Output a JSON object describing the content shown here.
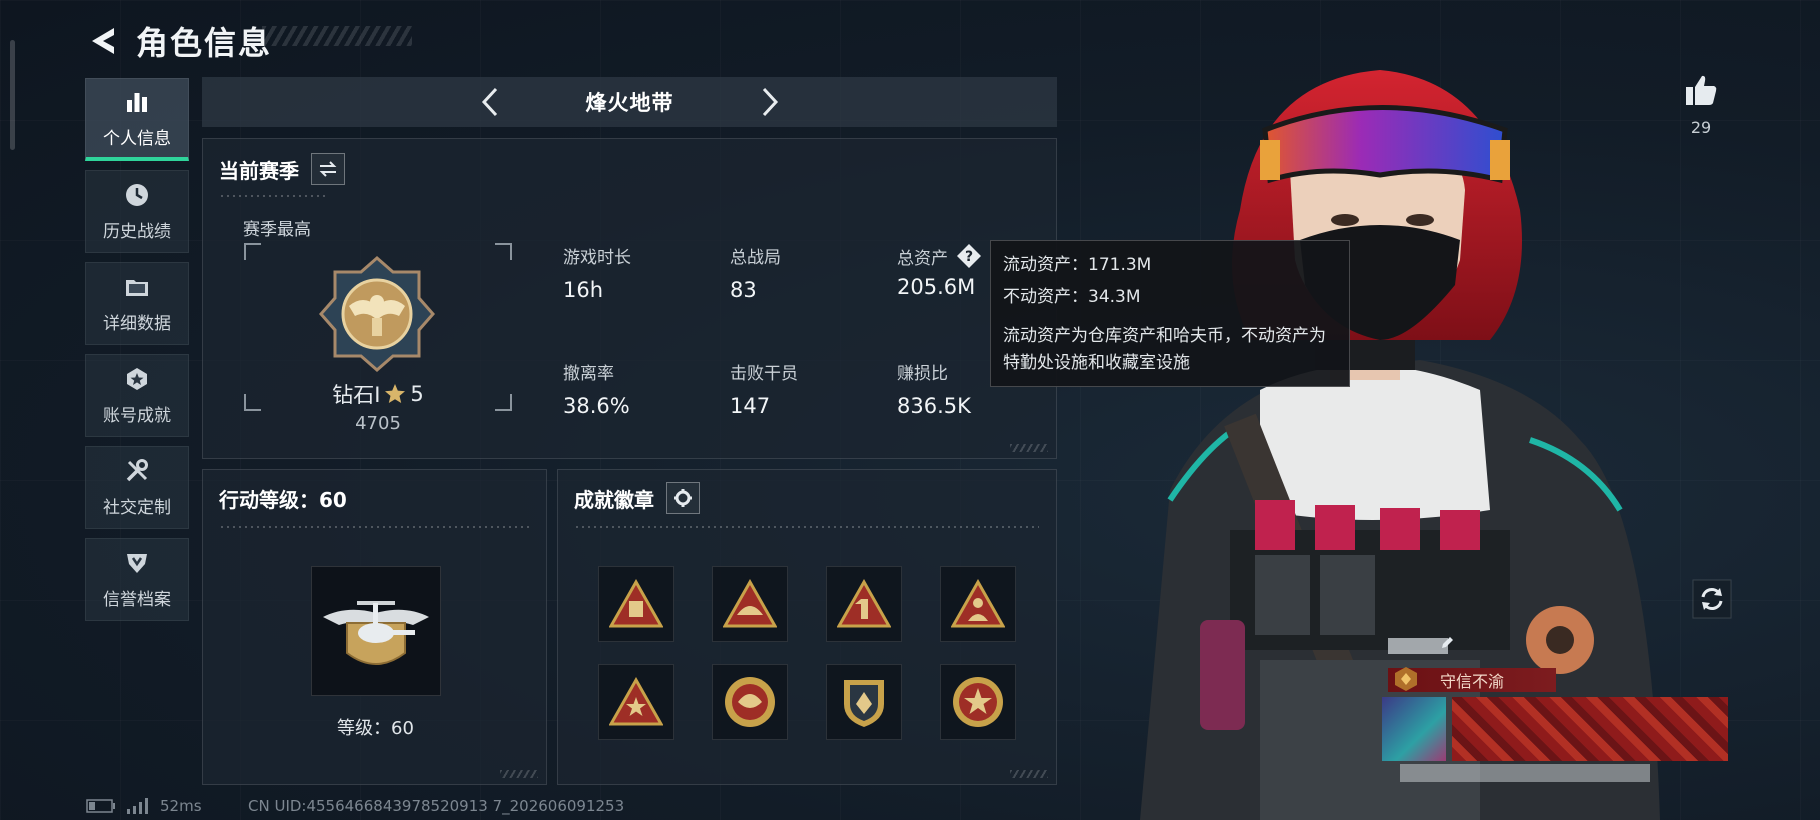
{
  "header": {
    "title": "角色信息"
  },
  "sidebar": {
    "items": [
      {
        "label": "个人信息",
        "icon": "bar-chart-icon",
        "active": true
      },
      {
        "label": "历史战绩",
        "icon": "clock-icon",
        "active": false
      },
      {
        "label": "详细数据",
        "icon": "folder-icon",
        "active": false
      },
      {
        "label": "账号成就",
        "icon": "star-emblem-icon",
        "active": false
      },
      {
        "label": "社交定制",
        "icon": "tools-icon",
        "active": false
      },
      {
        "label": "信誉档案",
        "icon": "shield-icon",
        "active": false
      }
    ]
  },
  "mode": {
    "title": "烽火地带"
  },
  "season": {
    "title": "当前赛季",
    "best_label": "赛季最高",
    "rank_name": "钻石I",
    "rank_stars": "5",
    "rank_score": "4705",
    "stats": [
      {
        "label": "游戏时长",
        "value": "16h"
      },
      {
        "label": "总战局",
        "value": "83"
      },
      {
        "label": "总资产",
        "value": "205.6M"
      },
      {
        "label": "撤离率",
        "value": "38.6%"
      },
      {
        "label": "击败干员",
        "value": "147"
      },
      {
        "label": "赚损比",
        "value": "836.5K"
      }
    ]
  },
  "tooltip": {
    "liquid": "流动资产：171.3M",
    "fixed": "不动资产：34.3M",
    "desc": "流动资产为仓库资产和哈夫币，不动资产为特勤处设施和收藏室设施"
  },
  "level": {
    "title": "行动等级：60",
    "label": "等级：60"
  },
  "achievements": {
    "title": "成就徽章",
    "badges": [
      {
        "icon": "triangle-badge-bag-icon",
        "color": "#b8342a"
      },
      {
        "icon": "triangle-badge-hat-icon",
        "color": "#b8342a"
      },
      {
        "icon": "triangle-badge-one-icon",
        "color": "#b8342a"
      },
      {
        "icon": "triangle-badge-soldier-icon",
        "color": "#b8342a"
      },
      {
        "icon": "triangle-badge-star-icon",
        "color": "#b8342a"
      },
      {
        "icon": "round-badge-crest-icon",
        "color": "#c8a24a"
      },
      {
        "icon": "shield-badge-icon",
        "color": "#c8a24a"
      },
      {
        "icon": "round-badge-star-icon",
        "color": "#c8a24a"
      }
    ]
  },
  "social": {
    "likes": "29",
    "honor_title": "守信不渝"
  },
  "footer": {
    "ping": "52ms",
    "uid": "CN UID:4556466843978520913 7_202606091253"
  },
  "colors": {
    "accent_green": "#2fd49b",
    "gold": "#c8a24a",
    "red": "#b8342a"
  }
}
